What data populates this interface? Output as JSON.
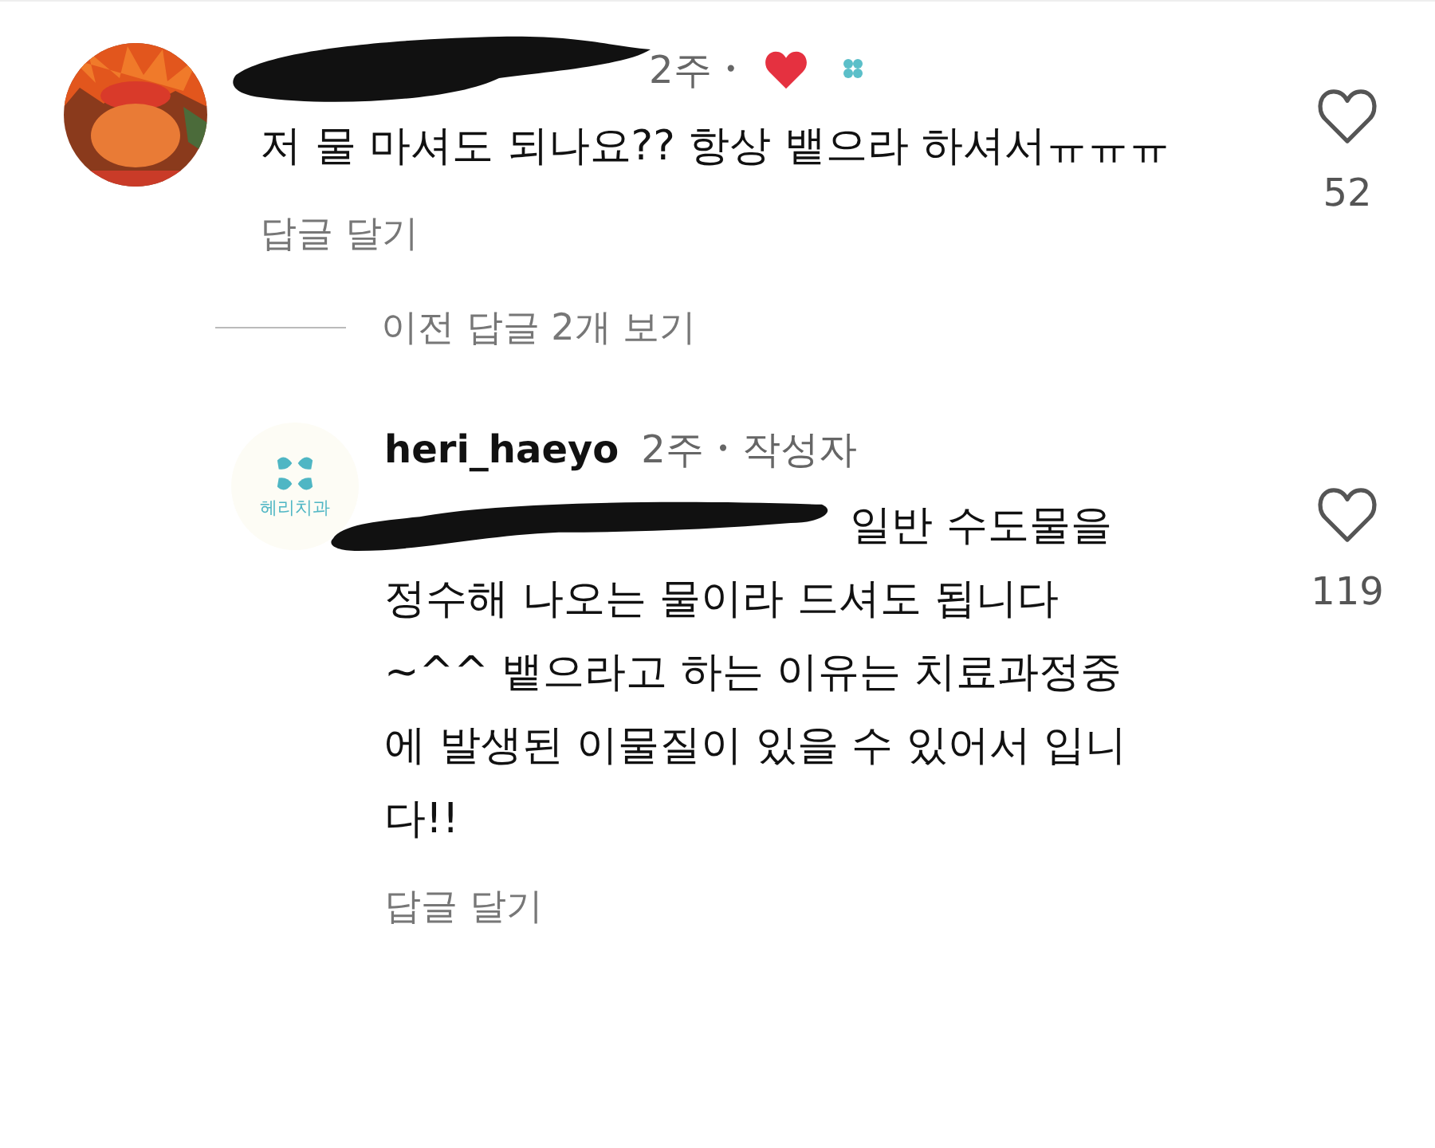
{
  "comment": {
    "time": "2주",
    "separator": "•",
    "liked_by_author": true,
    "text": "저 물 마셔도 되나요?? 항상 뱉으라 하셔서ㅠㅠㅠ",
    "reply_action": "답글 달기",
    "likes": "52"
  },
  "view_replies": "이전 답글 2개 보기",
  "reply": {
    "username": "heri_haeyo",
    "time": "2주",
    "separator": "•",
    "badge": "작성자",
    "avatar_logo": "헤리치과",
    "text_first_line": "일반 수도물을",
    "text": "정수해 나오는 물이라 드셔도 됩니다~^^ 뱉으라고 하는 이유는 치료과정중에 발생된 이물질이 있을 수 있어서 입니다!!",
    "reply_action": "답글 달기",
    "likes": "119"
  }
}
